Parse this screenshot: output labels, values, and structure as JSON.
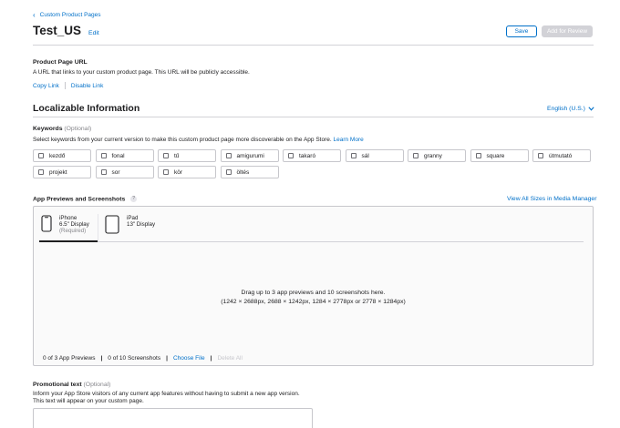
{
  "breadcrumb": {
    "label": "Custom Product Pages"
  },
  "header": {
    "title": "Test_US",
    "edit_label": "Edit",
    "save_label": "Save",
    "review_label": "Add for Review"
  },
  "product_url": {
    "label": "Product Page URL",
    "description": "A URL that links to your custom product page. This URL will be publicly accessible.",
    "copy_label": "Copy Link",
    "disable_label": "Disable Link"
  },
  "localizable": {
    "title": "Localizable Information",
    "language": "English (U.S.)"
  },
  "keywords": {
    "label": "Keywords",
    "optional": "(Optional)",
    "description": "Select keywords from your current version to make this custom product page more discoverable on the App Store.",
    "learn_more": "Learn More",
    "items": [
      "kezdő",
      "fonal",
      "tű",
      "amigurumi",
      "takaró",
      "sál",
      "granny",
      "square",
      "útmutató",
      "projekt",
      "sor",
      "kör",
      "öltés"
    ]
  },
  "media": {
    "label": "App Previews and Screenshots",
    "help": "?",
    "view_all": "View All Sizes in Media Manager",
    "tabs": [
      {
        "name": "iPhone",
        "size": "6.5\" Display",
        "note": "(Required)"
      },
      {
        "name": "iPad",
        "size": "13\" Display",
        "note": ""
      }
    ],
    "drop_line1": "Drag up to 3 app previews and 10 screenshots here.",
    "drop_line2": "(1242 × 2688px, 2688 × 1242px, 1284 × 2778px or 2778 × 1284px)",
    "previews_count": "0 of 3 App Previews",
    "screenshots_count": "0 of 10 Screenshots",
    "choose_file": "Choose File",
    "delete_all": "Delete All"
  },
  "promo": {
    "label": "Promotional text",
    "optional": "(Optional)",
    "line1": "Inform your App Store visitors of any current app features without having to submit a new app version.",
    "line2": "This text will appear on your custom page."
  }
}
